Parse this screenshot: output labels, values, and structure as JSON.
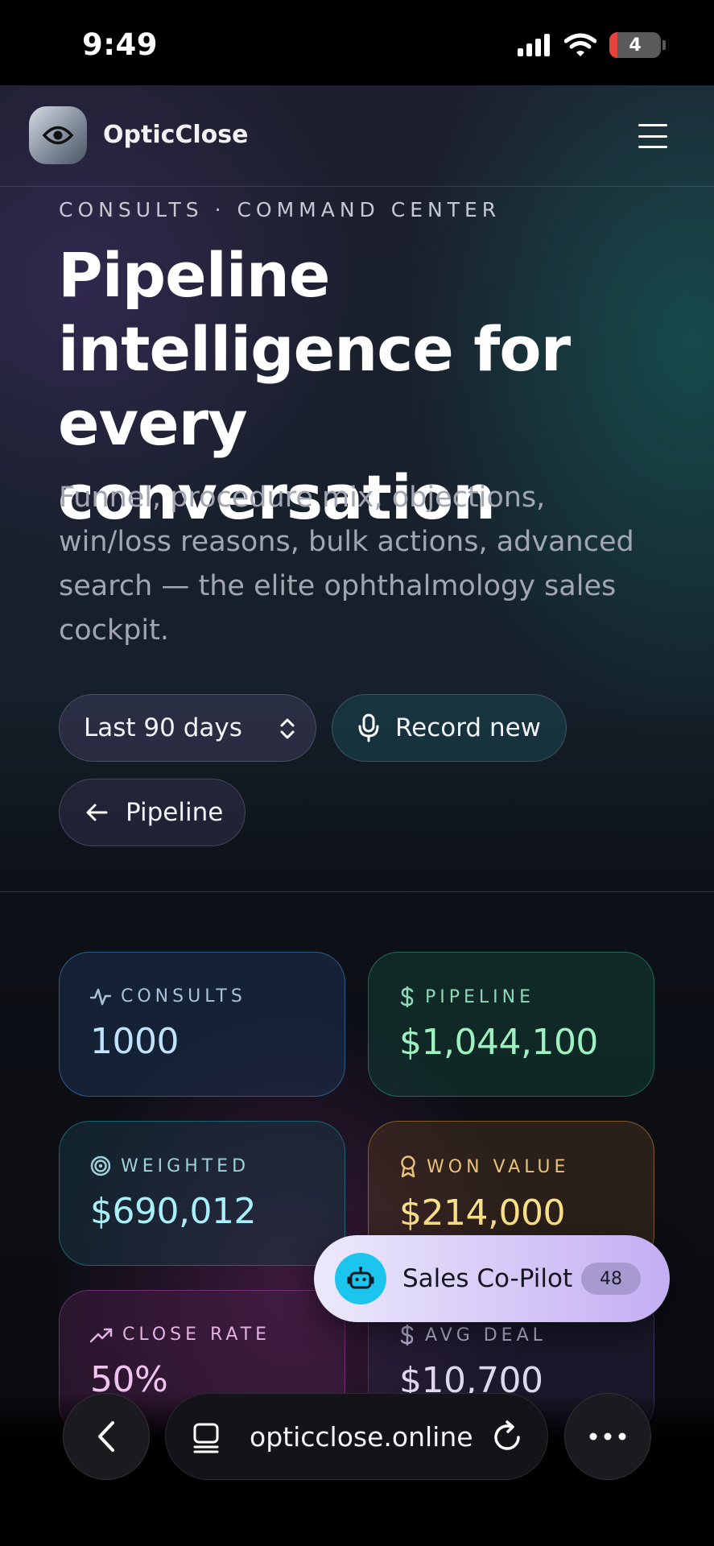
{
  "status_bar": {
    "time": "9:49",
    "battery": "4"
  },
  "header": {
    "brand": "OpticClose"
  },
  "hero": {
    "eyebrow": "CONSULTS · COMMAND CENTER",
    "title": "Pipeline intelligence for every conversation",
    "subtitle": "Funnel, procedure mix, objections, win/loss reasons, bulk actions, advanced search — the elite ophthalmology sales cockpit."
  },
  "controls": {
    "range_label": "Last 90 days",
    "record_label": "Record new",
    "pipeline_label": "Pipeline"
  },
  "stats": [
    {
      "label": "CONSULTS",
      "value": "1000",
      "icon": "pulse-icon"
    },
    {
      "label": "PIPELINE",
      "value": "$1,044,100",
      "icon": "dollar-icon"
    },
    {
      "label": "WEIGHTED",
      "value": "$690,012",
      "icon": "target-icon"
    },
    {
      "label": "WON VALUE",
      "value": "$214,000",
      "icon": "award-icon"
    },
    {
      "label": "CLOSE RATE",
      "value": "50%",
      "icon": "trending-up-icon"
    },
    {
      "label": "AVG DEAL",
      "value": "$10,700",
      "icon": "dollar-icon"
    }
  ],
  "copilot": {
    "label": "Sales Co-Pilot",
    "badge": "48"
  },
  "browser": {
    "url": "opticclose.online"
  },
  "colors": {
    "accent_teal": "#1cc5ee",
    "copilot_bg": "#d4c6f7"
  }
}
